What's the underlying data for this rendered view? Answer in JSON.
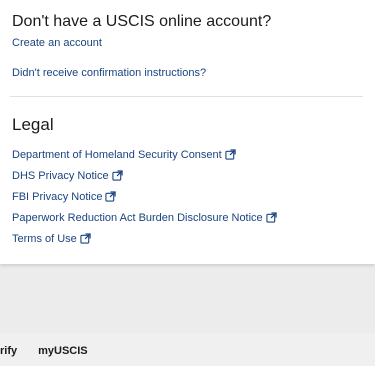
{
  "account_section": {
    "title": "Don't have a USCIS online account?",
    "create_account_link": "Create an account",
    "resend_confirmation_link": "Didn't receive confirmation instructions?"
  },
  "legal_section": {
    "heading": "Legal",
    "links": [
      {
        "label": "Department of Homeland Security Consent",
        "icon": "external-link-icon"
      },
      {
        "label": "DHS Privacy Notice",
        "icon": "external-link-icon"
      },
      {
        "label": "FBI Privacy Notice",
        "icon": "external-link-icon"
      },
      {
        "label": "Paperwork Reduction Act Burden Disclosure Notice",
        "icon": "external-link-icon"
      },
      {
        "label": "Terms of Use",
        "icon": "external-link-icon"
      }
    ]
  },
  "footer_nav": {
    "items": [
      "rify",
      "myUSCIS"
    ]
  },
  "colors": {
    "link": "#1a4480",
    "text": "#1b1b1b",
    "background": "#ececec",
    "card": "#ffffff",
    "divider": "#dfe1e2"
  }
}
